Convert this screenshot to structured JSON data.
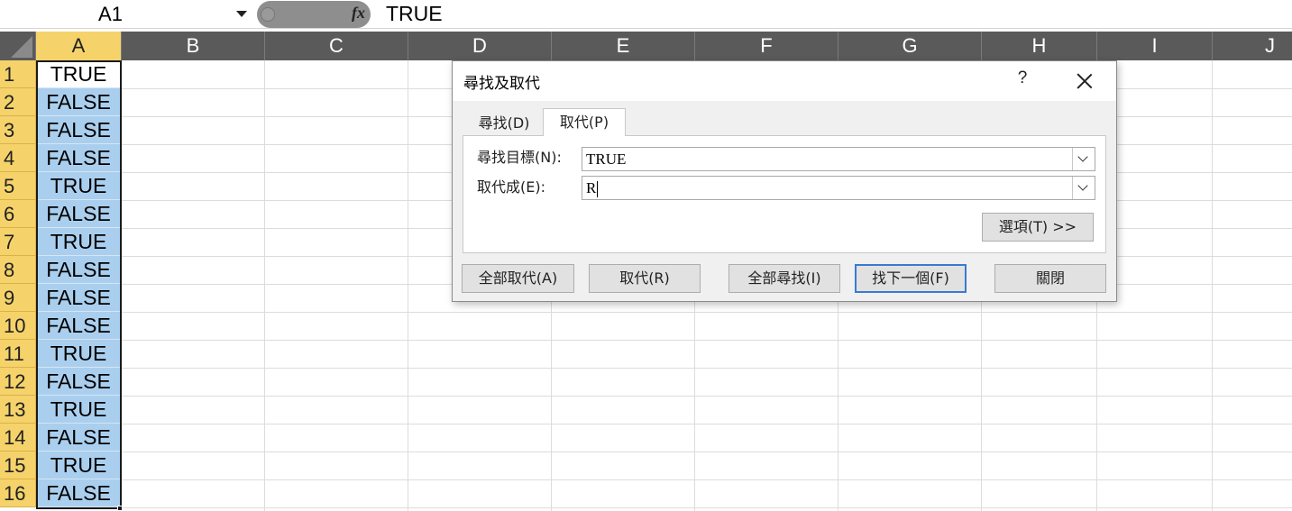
{
  "formula_bar": {
    "name_box": "A1",
    "fx_label": "fx",
    "value": "TRUE"
  },
  "columns": [
    "A",
    "B",
    "C",
    "D",
    "E",
    "F",
    "G",
    "H",
    "I",
    "J"
  ],
  "rows": [
    "1",
    "2",
    "3",
    "4",
    "5",
    "6",
    "7",
    "8",
    "9",
    "10",
    "11",
    "12",
    "13",
    "14",
    "15",
    "16"
  ],
  "column_a": [
    "TRUE",
    "FALSE",
    "FALSE",
    "FALSE",
    "TRUE",
    "FALSE",
    "TRUE",
    "FALSE",
    "FALSE",
    "FALSE",
    "TRUE",
    "FALSE",
    "TRUE",
    "FALSE",
    "TRUE",
    "FALSE"
  ],
  "dialog": {
    "title": "尋找及取代",
    "help": "?",
    "tabs": {
      "find": "尋找(D)",
      "replace": "取代(P)"
    },
    "find_label": "尋找目標(N):",
    "find_value": "TRUE",
    "replace_label": "取代成(E):",
    "replace_value": "R",
    "options_button": "選項(T) >>",
    "buttons": {
      "replace_all": "全部取代(A)",
      "replace": "取代(R)",
      "find_all": "全部尋找(I)",
      "find_next": "找下一個(F)",
      "close": "關閉"
    }
  },
  "colors": {
    "header_bg": "#5a5a5a",
    "active_header": "#f5d36a",
    "selection_fill": "#aacfee",
    "default_button_border": "#3a7ad1"
  }
}
